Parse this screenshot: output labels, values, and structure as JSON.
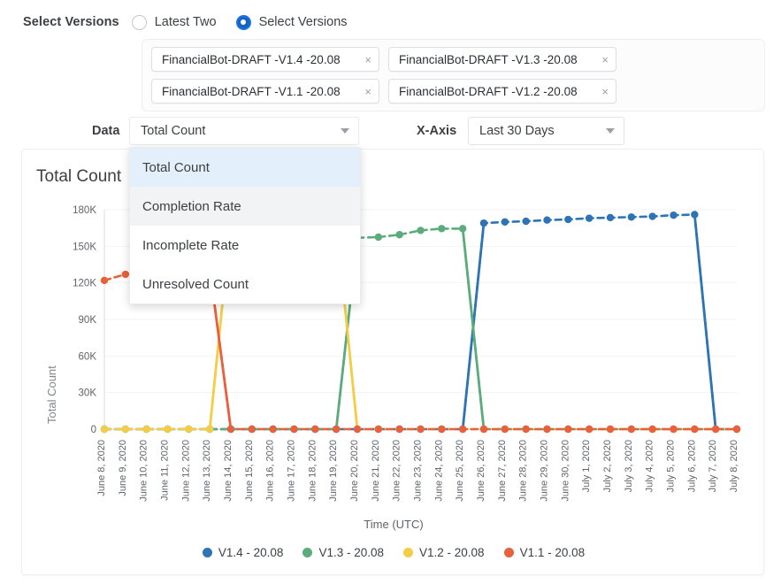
{
  "version_selector": {
    "label": "Select Versions",
    "options": [
      {
        "label": "Latest Two",
        "selected": false
      },
      {
        "label": "Select Versions",
        "selected": true
      }
    ]
  },
  "chips": [
    {
      "label": "FinancialBot-DRAFT -V1.4 -20.08",
      "remove": "×"
    },
    {
      "label": "FinancialBot-DRAFT -V1.3 -20.08",
      "remove": "×"
    },
    {
      "label": "FinancialBot-DRAFT -V1.1 -20.08",
      "remove": "×"
    },
    {
      "label": "FinancialBot-DRAFT -V1.2 -20.08",
      "remove": "×"
    }
  ],
  "controls": {
    "data_label": "Data",
    "data_value": "Total Count",
    "xaxis_label": "X-Axis",
    "xaxis_value": "Last 30 Days"
  },
  "dropdown": {
    "open": true,
    "items": [
      {
        "label": "Total Count",
        "state": "selected"
      },
      {
        "label": "Completion Rate",
        "state": "hover"
      },
      {
        "label": "Incomplete Rate",
        "state": "normal"
      },
      {
        "label": "Unresolved Count",
        "state": "normal"
      }
    ]
  },
  "card": {
    "title": "Total Count"
  },
  "colors": {
    "v14_blue": "#2d74b5",
    "v13_green": "#5cab7d",
    "v12_yellow": "#f4cd46",
    "v11_red": "#e8603c",
    "accent": "#1565c0",
    "grid": "#f1f3f4",
    "axis": "#dadce0"
  },
  "chart_data": {
    "type": "line",
    "title": "Total Count",
    "xlabel": "Time (UTC)",
    "ylabel": "Total Count",
    "ylim": [
      0,
      180000
    ],
    "yticks": [
      0,
      30000,
      60000,
      90000,
      120000,
      150000,
      180000
    ],
    "ytick_labels": [
      "0",
      "30K",
      "60K",
      "90K",
      "120K",
      "150K",
      "180K"
    ],
    "grid": true,
    "legend_position": "bottom",
    "categories": [
      "June 8, 2020",
      "June 9, 2020",
      "June 10, 2020",
      "June 11, 2020",
      "June 12, 2020",
      "June 13, 2020",
      "June 14, 2020",
      "June 15, 2020",
      "June 16, 2020",
      "June 17, 2020",
      "June 18, 2020",
      "June 19, 2020",
      "June 20, 2020",
      "June 21, 2020",
      "June 22, 2020",
      "June 23, 2020",
      "June 24, 2020",
      "June 25, 2020",
      "June 26, 2020",
      "June 27, 2020",
      "June 28, 2020",
      "June 29, 2020",
      "June 30, 2020",
      "July 1, 2020",
      "July 2, 2020",
      "July 3, 2020",
      "July 4, 2020",
      "July 5, 2020",
      "July 6, 2020",
      "July 7, 2020",
      "July 8, 2020"
    ],
    "series": [
      {
        "name": "V1.4 - 20.08",
        "color": "#2d74b5",
        "values": [
          0,
          0,
          0,
          0,
          0,
          0,
          0,
          0,
          0,
          0,
          0,
          0,
          0,
          0,
          0,
          0,
          0,
          0,
          169000,
          170000,
          170500,
          171500,
          172000,
          173000,
          173500,
          174000,
          174500,
          175500,
          176000,
          0,
          0
        ]
      },
      {
        "name": "V1.3 - 20.08",
        "color": "#5cab7d",
        "values": [
          0,
          0,
          0,
          0,
          0,
          0,
          0,
          0,
          0,
          0,
          0,
          0,
          157000,
          157500,
          159500,
          163000,
          164500,
          164500,
          0,
          0,
          0,
          0,
          0,
          0,
          0,
          0,
          0,
          0,
          0,
          0,
          0
        ]
      },
      {
        "name": "V1.2 - 20.08",
        "color": "#f4cd46",
        "values": [
          0,
          0,
          0,
          0,
          0,
          0,
          171000,
          171000,
          171000,
          171000,
          171000,
          171000,
          0,
          0,
          0,
          0,
          0,
          0,
          0,
          0,
          0,
          0,
          0,
          0,
          0,
          0,
          0,
          0,
          0,
          0,
          0
        ]
      },
      {
        "name": "V1.1 - 20.08",
        "color": "#e8603c",
        "values": [
          122000,
          127000,
          129000,
          130000,
          131000,
          132000,
          0,
          0,
          0,
          0,
          0,
          0,
          0,
          0,
          0,
          0,
          0,
          0,
          0,
          0,
          0,
          0,
          0,
          0,
          0,
          0,
          0,
          0,
          0,
          0,
          0
        ]
      }
    ]
  },
  "legend": [
    {
      "label": "V1.4 - 20.08",
      "color": "#2d74b5"
    },
    {
      "label": "V1.3 - 20.08",
      "color": "#5cab7d"
    },
    {
      "label": "V1.2 - 20.08",
      "color": "#f4cd46"
    },
    {
      "label": "V1.1 - 20.08",
      "color": "#e8603c"
    }
  ]
}
